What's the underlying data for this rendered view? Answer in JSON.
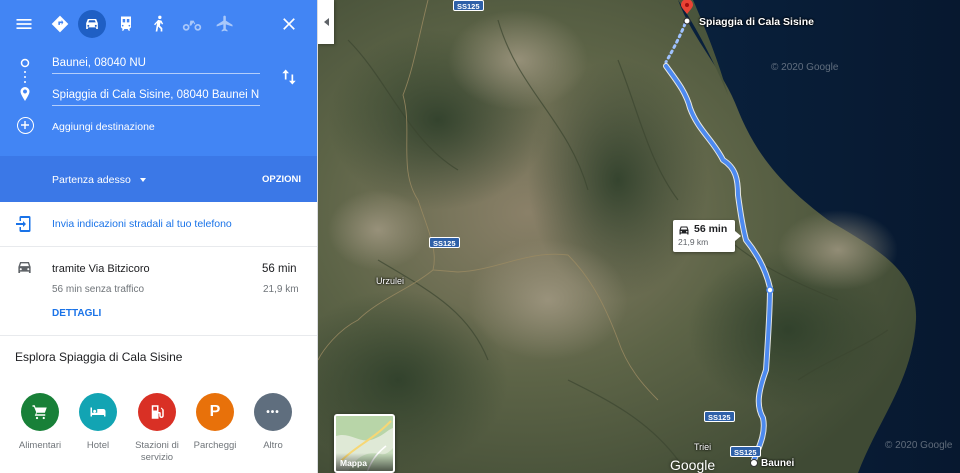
{
  "travel_modes": [
    {
      "name": "directions-mode"
    },
    {
      "name": "car-mode"
    },
    {
      "name": "transit-mode"
    },
    {
      "name": "walk-mode"
    },
    {
      "name": "bike-mode"
    },
    {
      "name": "flight-mode"
    }
  ],
  "origin": "Baunei, 08040 NU",
  "destination": "Spiaggia di Cala Sisine, 08040 Baunei N",
  "add_destination": "Aggiungi destinazione",
  "depart_label": "Partenza adesso",
  "options_label": "OPZIONI",
  "send_to_phone": "Invia indicazioni stradali al tuo telefono",
  "route": {
    "via": "tramite Via Bitzicoro",
    "duration": "56 min",
    "traffic_note": "56 min senza traffico",
    "distance": "21,9 km",
    "details_label": "DETTAGLI"
  },
  "explore": {
    "title": "Esplora Spiaggia di Cala Sisine",
    "categories": [
      {
        "label": "Alimentari",
        "icon": "cart-icon",
        "color": "#188038"
      },
      {
        "label": "Hotel",
        "icon": "bed-icon",
        "color": "#12a4b3"
      },
      {
        "label": "Stazioni di",
        "label2": "servizio",
        "icon": "fuel-icon",
        "color": "#d93025"
      },
      {
        "label": "Parcheggi",
        "icon": "parking-icon",
        "glyph": "P",
        "color": "#e8710a"
      },
      {
        "label": "Altro",
        "icon": "more-icon",
        "glyph": "•••",
        "color": "#5f6e7e"
      }
    ]
  },
  "map": {
    "destination_label": "Spiaggia di Cala Sisine",
    "origin_label": "Baunei",
    "route_duration": "56 min",
    "route_distance": "21,9 km",
    "town_labels": [
      "Urzulei",
      "Triei"
    ],
    "road_labels": [
      "SS125",
      "SS125",
      "SS125",
      "SS125"
    ],
    "google_logo": "Google",
    "watermark": "© 2020 Google",
    "layer_toggle_label": "Mappa",
    "route_color": "#4d8af0"
  }
}
